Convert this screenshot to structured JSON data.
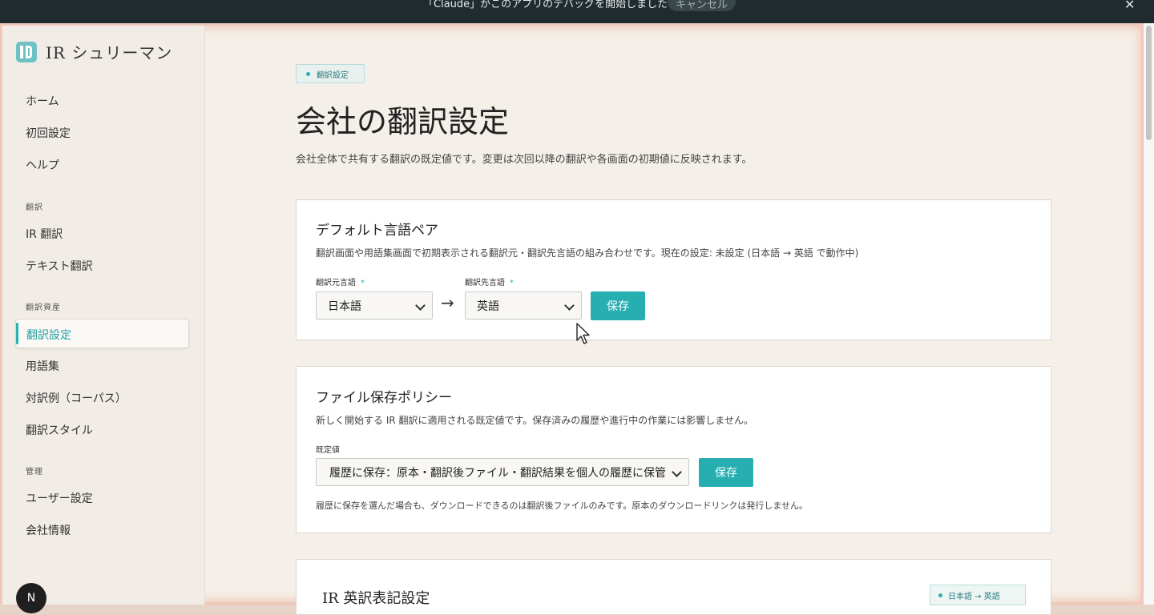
{
  "notification": {
    "message": "「Claude」がこのアプリのデバッグを開始しました",
    "cancel_label": "キャンセル",
    "close_icon": "✕"
  },
  "sidebar": {
    "brand": "IR シュリーマン",
    "items_top": [
      "ホーム",
      "初回設定",
      "ヘルプ"
    ],
    "section_translation": "翻訳",
    "items_translation": [
      "IR 翻訳",
      "テキスト翻訳"
    ],
    "section_assets": "翻訳資産",
    "active_item": "翻訳設定",
    "items_assets": [
      "用語集",
      "対訳例（コーパス）",
      "翻訳スタイル"
    ],
    "section_admin": "管理",
    "items_admin": [
      "ユーザー設定",
      "会社情報"
    ],
    "avatar_letter": "N"
  },
  "main": {
    "pill": "翻訳設定",
    "title": "会社の翻訳設定",
    "description": "会社全体で共有する翻訳の既定値です。変更は次回以降の翻訳や各画面の初期値に反映されます。",
    "lang_pair_card": {
      "title": "デフォルト言語ペア",
      "description": "翻訳画面や用語集画面で初期表示される翻訳元・翻訳先言語の組み合わせです。現在の設定: 未設定 (日本語 → 英語 で動作中)",
      "source_label": "翻訳元言語",
      "target_label": "翻訳先言語",
      "required_mark": "*",
      "source_value": "日本語",
      "target_value": "英語",
      "arrow": "→",
      "save_label": "保存"
    },
    "file_policy_card": {
      "title": "ファイル保存ポリシー",
      "description": "新しく開始する IR 翻訳に適用される既定値です。保存済みの履歴や進行中の作業には影響しません。",
      "field_label": "既定値",
      "value": "履歴に保存：原本・翻訳後ファイル・翻訳結果を個人の履歴に保管",
      "save_label": "保存",
      "note": "履歴に保存を選んだ場合も、ダウンロードできるのは翻訳後ファイルのみです。原本のダウンロードリンクは発行しません。"
    },
    "ir_card": {
      "title": "IR 英訳表記設定",
      "tag": "日本語 → 英語"
    }
  },
  "colors": {
    "accent": "#26aeb1",
    "top_bar": "#1f2b2e",
    "background": "#f4efe8"
  }
}
